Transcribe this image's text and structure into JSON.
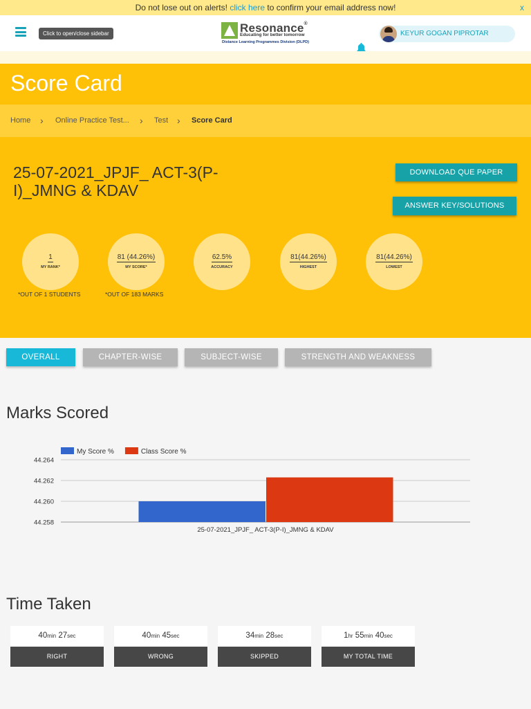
{
  "alert": {
    "before": "Do not lose out on alerts!",
    "link": "click here",
    "after": "to confirm your email address now!",
    "close": "x"
  },
  "header": {
    "sidebar_tip": "Click to open/close sidebar",
    "logo_name": "Resonance",
    "logo_reg": "®",
    "logo_tagline": "Educating for better tomorrow",
    "logo_division": "Distance Learning Programmes Division (DLPD)",
    "user_name": "KEYUR GOGAN PIPROTAR"
  },
  "page": {
    "title": "Score Card"
  },
  "breadcrumb": [
    "Home",
    "Online Practice Test...",
    "Test",
    "Score Card"
  ],
  "test": {
    "name": "25-07-2021_JPJF_ ACT-3(P-I)_JMNG & KDAV",
    "download_label": "DOWNLOAD QUE PAPER",
    "answer_label": "ANSWER KEY/SOLUTIONS"
  },
  "stats": [
    {
      "value": "1",
      "label": "MY RANK*",
      "note": "*OUT OF 1 STUDENTS"
    },
    {
      "value": "81 (44.26%)",
      "label": "MY SCORE*",
      "note": "*OUT OF 183 MARKS"
    },
    {
      "value": "62.5%",
      "label": "ACCURACY",
      "note": ""
    },
    {
      "value": "81(44.26%)",
      "label": "HIGHEST",
      "note": ""
    },
    {
      "value": "81(44.26%)",
      "label": "LOWEST",
      "note": ""
    }
  ],
  "tabs": [
    {
      "label": "OVERALL",
      "active": true
    },
    {
      "label": "CHAPTER-WISE",
      "active": false
    },
    {
      "label": "SUBJECT-WISE",
      "active": false
    },
    {
      "label": "STRENGTH AND WEAKNESS",
      "active": false
    }
  ],
  "sections": {
    "marks": "Marks Scored",
    "time": "Time Taken"
  },
  "chart_data": {
    "type": "bar",
    "categories": [
      "25-07-2021_JPJF_ ACT-3(P-I)_JMNG & KDAV"
    ],
    "series": [
      {
        "name": "My Score %",
        "values": [
          44.26
        ],
        "color": "#3366cc"
      },
      {
        "name": "Class Score %",
        "values": [
          44.2623
        ],
        "color": "#dc3912"
      }
    ],
    "ylim": [
      44.258,
      44.264
    ],
    "yticks": [
      "44.258",
      "44.260",
      "44.262",
      "44.264"
    ],
    "grid": true,
    "legend": "top-left"
  },
  "time_taken": [
    {
      "parts": [
        {
          "n": "40",
          "u": "min"
        },
        {
          "n": "27",
          "u": "sec"
        }
      ],
      "label": "RIGHT"
    },
    {
      "parts": [
        {
          "n": "40",
          "u": "min"
        },
        {
          "n": "45",
          "u": "sec"
        }
      ],
      "label": "WRONG"
    },
    {
      "parts": [
        {
          "n": "34",
          "u": "min"
        },
        {
          "n": "28",
          "u": "sec"
        }
      ],
      "label": "SKIPPED"
    },
    {
      "parts": [
        {
          "n": "1",
          "u": "hr"
        },
        {
          "n": "55",
          "u": "min"
        },
        {
          "n": "40",
          "u": "sec"
        }
      ],
      "label": "MY TOTAL TIME"
    }
  ]
}
